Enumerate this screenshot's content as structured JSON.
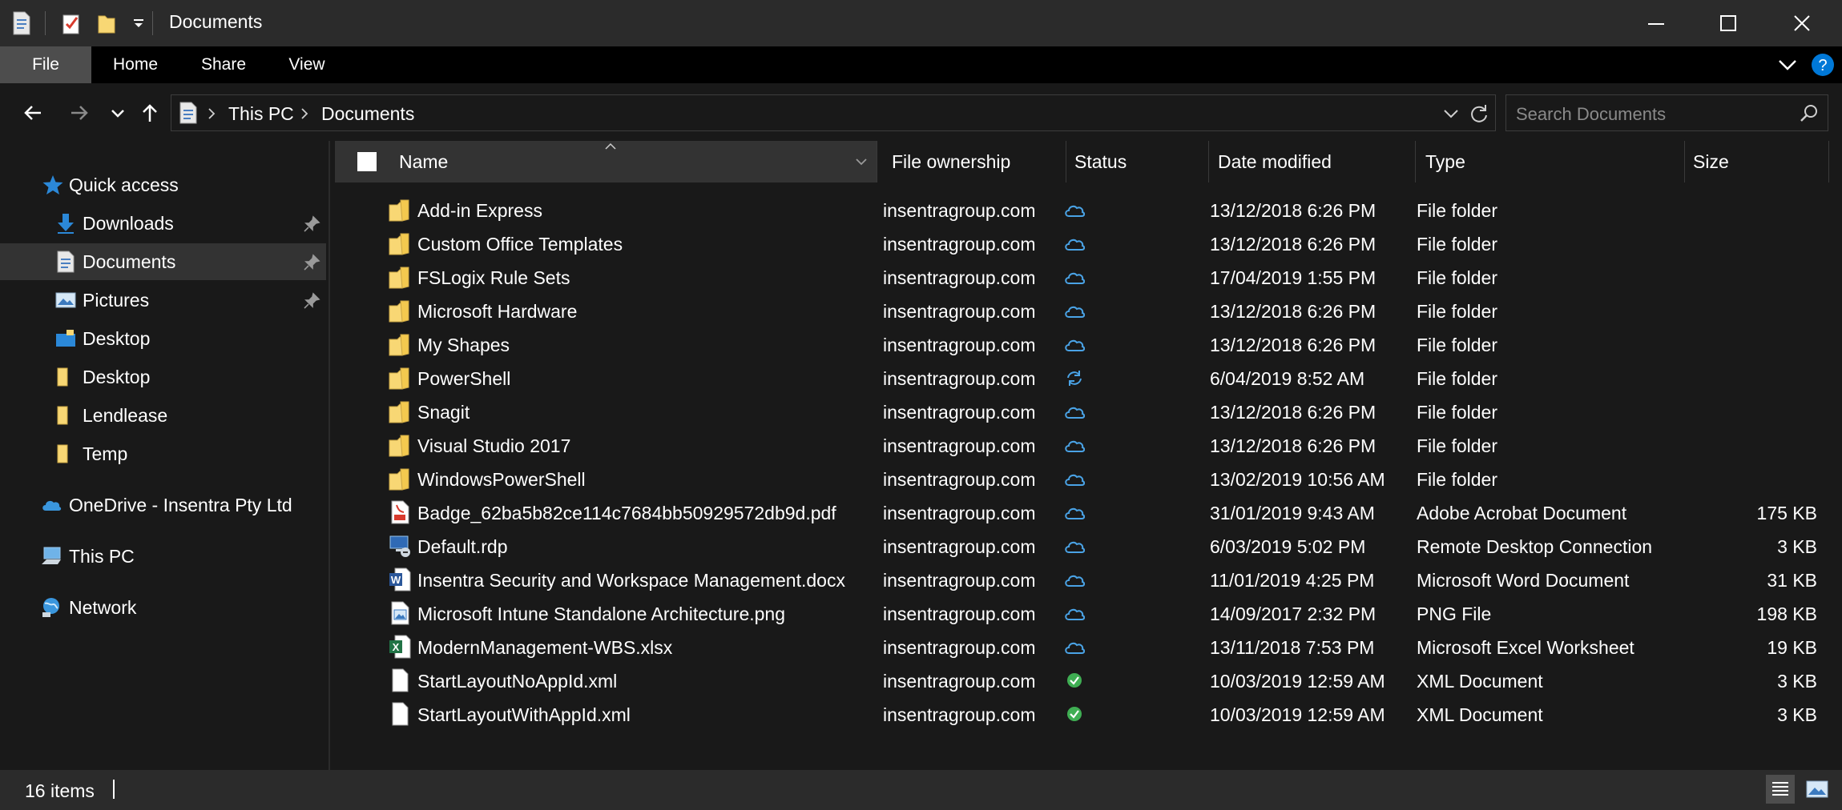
{
  "window": {
    "title": "Documents",
    "quick_access_icons": [
      "document-properties-icon",
      "checklist-icon",
      "new-folder-icon",
      "customize-dropdown-icon"
    ],
    "controls": [
      "minimize-icon",
      "maximize-icon",
      "close-icon"
    ]
  },
  "ribbon": {
    "tabs": [
      "File",
      "Home",
      "Share",
      "View"
    ],
    "icons": [
      "expand-ribbon-icon",
      "help-icon"
    ]
  },
  "address": {
    "segments": [
      "This PC",
      "Documents"
    ],
    "search_placeholder": "Search Documents"
  },
  "sidebar": {
    "quick_access": "Quick access",
    "items": [
      {
        "label": "Downloads",
        "icon": "downloads-icon",
        "pinned": true
      },
      {
        "label": "Documents",
        "icon": "documents-icon",
        "pinned": true,
        "selected": true
      },
      {
        "label": "Pictures",
        "icon": "pictures-icon",
        "pinned": true
      },
      {
        "label": "Desktop",
        "icon": "desktop-folder-icon"
      },
      {
        "label": "Desktop",
        "icon": "folder-icon"
      },
      {
        "label": "Lendlease",
        "icon": "folder-icon"
      },
      {
        "label": "Temp",
        "icon": "folder-icon"
      }
    ],
    "onedrive": "OneDrive - Insentra Pty Ltd",
    "this_pc": "This PC",
    "network": "Network"
  },
  "columns": {
    "name": "Name",
    "ownership": "File ownership",
    "status": "Status",
    "date": "Date modified",
    "type": "Type",
    "size": "Size"
  },
  "files": [
    {
      "name": "Add-in Express",
      "owner": "insentragroup.com",
      "status": "cloud",
      "date": "13/12/2018 6:26 PM",
      "type": "File folder",
      "size": "",
      "icon": "folder"
    },
    {
      "name": "Custom Office Templates",
      "owner": "insentragroup.com",
      "status": "cloud",
      "date": "13/12/2018 6:26 PM",
      "type": "File folder",
      "size": "",
      "icon": "folder"
    },
    {
      "name": "FSLogix Rule Sets",
      "owner": "insentragroup.com",
      "status": "cloud",
      "date": "17/04/2019 1:55 PM",
      "type": "File folder",
      "size": "",
      "icon": "folder"
    },
    {
      "name": "Microsoft Hardware",
      "owner": "insentragroup.com",
      "status": "cloud",
      "date": "13/12/2018 6:26 PM",
      "type": "File folder",
      "size": "",
      "icon": "folder"
    },
    {
      "name": "My Shapes",
      "owner": "insentragroup.com",
      "status": "cloud",
      "date": "13/12/2018 6:26 PM",
      "type": "File folder",
      "size": "",
      "icon": "folder"
    },
    {
      "name": "PowerShell",
      "owner": "insentragroup.com",
      "status": "sync",
      "date": "6/04/2019 8:52 AM",
      "type": "File folder",
      "size": "",
      "icon": "folder"
    },
    {
      "name": "Snagit",
      "owner": "insentragroup.com",
      "status": "cloud",
      "date": "13/12/2018 6:26 PM",
      "type": "File folder",
      "size": "",
      "icon": "folder"
    },
    {
      "name": "Visual Studio 2017",
      "owner": "insentragroup.com",
      "status": "cloud",
      "date": "13/12/2018 6:26 PM",
      "type": "File folder",
      "size": "",
      "icon": "folder"
    },
    {
      "name": "WindowsPowerShell",
      "owner": "insentragroup.com",
      "status": "cloud",
      "date": "13/02/2019 10:56 AM",
      "type": "File folder",
      "size": "",
      "icon": "folder"
    },
    {
      "name": "Badge_62ba5b82ce114c7684bb50929572db9d.pdf",
      "owner": "insentragroup.com",
      "status": "cloud",
      "date": "31/01/2019 9:43 AM",
      "type": "Adobe Acrobat Document",
      "size": "175 KB",
      "icon": "pdf"
    },
    {
      "name": "Default.rdp",
      "owner": "insentragroup.com",
      "status": "cloud",
      "date": "6/03/2019 5:02 PM",
      "type": "Remote Desktop Connection",
      "size": "3 KB",
      "icon": "rdp"
    },
    {
      "name": "Insentra Security and Workspace Management.docx",
      "owner": "insentragroup.com",
      "status": "cloud",
      "date": "11/01/2019 4:25 PM",
      "type": "Microsoft Word Document",
      "size": "31 KB",
      "icon": "word"
    },
    {
      "name": "Microsoft Intune Standalone Architecture.png",
      "owner": "insentragroup.com",
      "status": "cloud",
      "date": "14/09/2017 2:32 PM",
      "type": "PNG File",
      "size": "198 KB",
      "icon": "image"
    },
    {
      "name": "ModernManagement-WBS.xlsx",
      "owner": "insentragroup.com",
      "status": "cloud",
      "date": "13/11/2018 7:53 PM",
      "type": "Microsoft Excel Worksheet",
      "size": "19 KB",
      "icon": "excel"
    },
    {
      "name": "StartLayoutNoAppId.xml",
      "owner": "insentragroup.com",
      "status": "local",
      "date": "10/03/2019 12:59 AM",
      "type": "XML Document",
      "size": "3 KB",
      "icon": "file"
    },
    {
      "name": "StartLayoutWithAppId.xml",
      "owner": "insentragroup.com",
      "status": "local",
      "date": "10/03/2019 12:59 AM",
      "type": "XML Document",
      "size": "3 KB",
      "icon": "file"
    }
  ],
  "statusbar": {
    "item_count": "16 items",
    "views": [
      "details-view-icon",
      "large-icons-view-icon"
    ]
  },
  "colors": {
    "folder": "#f8d774",
    "cloud": "#4aa3e6",
    "ok": "#3fae53",
    "accent": "#0078d7"
  }
}
